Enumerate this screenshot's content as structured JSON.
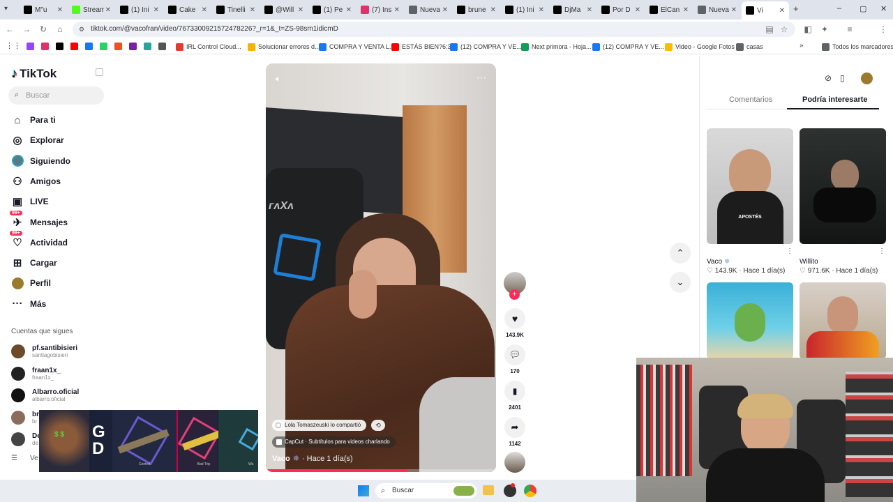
{
  "tabs": [
    {
      "title": "M\"u",
      "color": "#000000"
    },
    {
      "title": "Stream",
      "color": "#53fc18"
    },
    {
      "title": "(1) Ini",
      "color": "#000000"
    },
    {
      "title": "Cake",
      "color": "#000000"
    },
    {
      "title": "Tinelli",
      "color": "#000000"
    },
    {
      "title": "@Will",
      "color": "#000000"
    },
    {
      "title": "(1) Pe",
      "color": "#000000"
    },
    {
      "title": "(7) Ins",
      "color": "#e1306c"
    },
    {
      "title": "Nueva",
      "color": "#5f6368"
    },
    {
      "title": "brune",
      "color": "#000000"
    },
    {
      "title": "(1) Ini",
      "color": "#000000"
    },
    {
      "title": "DjMa",
      "color": "#000000"
    },
    {
      "title": "Por D",
      "color": "#000000"
    },
    {
      "title": "ElCan",
      "color": "#000000"
    },
    {
      "title": "Nueva",
      "color": "#5f6368"
    },
    {
      "title": "Vi",
      "color": "#000000"
    }
  ],
  "url": "tiktok.com/@vacofran/video/7673300921572478226?_r=1&_t=ZS-98sm1idicmD",
  "bookmarks": [
    {
      "label": "IRL Control Cloud...",
      "color": "#e53935"
    },
    {
      "label": "Solucionar errores d...",
      "color": "#f4b400"
    },
    {
      "label": "COMPRA Y VENTA L...",
      "color": "#1877f2"
    },
    {
      "label": "ESTÁS BIEN?6:33",
      "color": "#ff0000"
    },
    {
      "label": "(12) COMPRA Y VE...",
      "color": "#1877f2"
    },
    {
      "label": "Next primora - Hoja...",
      "color": "#0f9d58"
    },
    {
      "label": "(12) COMPRA Y VE...",
      "color": "#1877f2"
    },
    {
      "label": "Video - Google Fotos",
      "color": "#fbbc05"
    },
    {
      "label": "casas",
      "color": "#5f6368"
    },
    {
      "label": "Todos los marcadores",
      "color": "#5f6368"
    }
  ],
  "tiktok": {
    "logo": "TikTok",
    "search_placeholder": "Buscar",
    "nav": [
      {
        "label": "Para ti",
        "icon": "home-icon"
      },
      {
        "label": "Explorar",
        "icon": "compass-icon"
      },
      {
        "label": "Siguiendo",
        "icon": "following-avatar-icon"
      },
      {
        "label": "Amigos",
        "icon": "friends-icon"
      },
      {
        "label": "LIVE",
        "icon": "live-icon"
      },
      {
        "label": "Mensajes",
        "icon": "messages-icon",
        "badge": "99+"
      },
      {
        "label": "Actividad",
        "icon": "activity-icon",
        "badge": "99+"
      },
      {
        "label": "Cargar",
        "icon": "upload-icon"
      },
      {
        "label": "Perfil",
        "icon": "profile-avatar-icon"
      },
      {
        "label": "Más",
        "icon": "more-icon"
      }
    ],
    "following_title": "Cuentas que sigues",
    "following": [
      {
        "name": "pf.santibisieri",
        "handle": "santiagobisieri",
        "color": "#6b4b2a"
      },
      {
        "name": "fraan1x_",
        "handle": "fraan1x_",
        "color": "#222222"
      },
      {
        "name": "Albarro.oficial",
        "handle": "albarro.oficial",
        "color": "#111111"
      },
      {
        "name": "br",
        "handle": "br",
        "color": "#8a6c5a"
      },
      {
        "name": "De",
        "handle": "de",
        "color": "#444444"
      }
    ],
    "see_more": "Ve",
    "video": {
      "shared_by": "Lola Tomaszeuski lo compartió",
      "capcut": "CapCut · Subtítulos para videos charlando",
      "author": "Vaco",
      "time": "· Hace 1 día(s)",
      "likes": "143.9K",
      "comments": "170",
      "saves": "2401",
      "shares": "1142"
    },
    "right_tabs": [
      "Comentarios",
      "Podría interesarte"
    ],
    "suggestions": [
      {
        "name": "Vaco",
        "likes": "143.9K",
        "time": "Hace 1 día(s)",
        "caption": "APOSTÉS"
      },
      {
        "name": "Willito",
        "likes": "971.6K",
        "time": "Hace 1 día(s)",
        "caption": ""
      }
    ]
  },
  "overlay_ad": {
    "text1": "G",
    "text2": "D",
    "skin1": "Control",
    "skin2": "Bad Trip",
    "skin3": "Wa"
  },
  "taskbar": {
    "search": "Buscar"
  }
}
